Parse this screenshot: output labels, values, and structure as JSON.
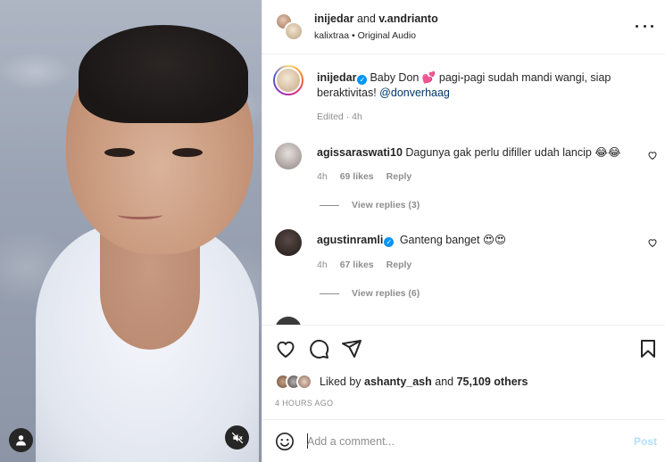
{
  "header": {
    "user1": "inijedar",
    "connector": " and ",
    "user2": "v.andrianto",
    "audio_user": "kalixtraa",
    "audio_sep": " • ",
    "audio_label": "Original Audio",
    "more_icon": "more-horizontal-icon"
  },
  "caption": {
    "username": "inijedar",
    "text": "Baby Don 💕 pagi-pagi sudah mandi wangi, siap beraktivitas! ",
    "mention": "@donverhaag",
    "meta": "Edited · 4h"
  },
  "comments": [
    {
      "username": "agissaraswati10",
      "text": "Dagunya gak perlu difiller udah lancip 😂😂",
      "time": "4h",
      "likes": "69 likes",
      "reply": "Reply",
      "view_replies": "View replies (3)",
      "verified": false
    },
    {
      "username": "agustinramli",
      "text": "Ganteng banget 😍😍",
      "time": "4h",
      "likes": "67 likes",
      "reply": "Reply",
      "view_replies": "View replies (6)",
      "verified": true
    }
  ],
  "actions": {
    "liked_by_prefix": "Liked by ",
    "liked_by_user": "ashanty_ash",
    "liked_by_mid": " and ",
    "liked_by_count": "75,109 others",
    "timestamp": "4 HOURS AGO"
  },
  "composer": {
    "placeholder": "Add a comment...",
    "post_label": "Post"
  },
  "colors": {
    "link": "#00376b",
    "verified": "#0095f6",
    "muted": "#8e8e8e",
    "post_disabled": "#b2dffc"
  }
}
